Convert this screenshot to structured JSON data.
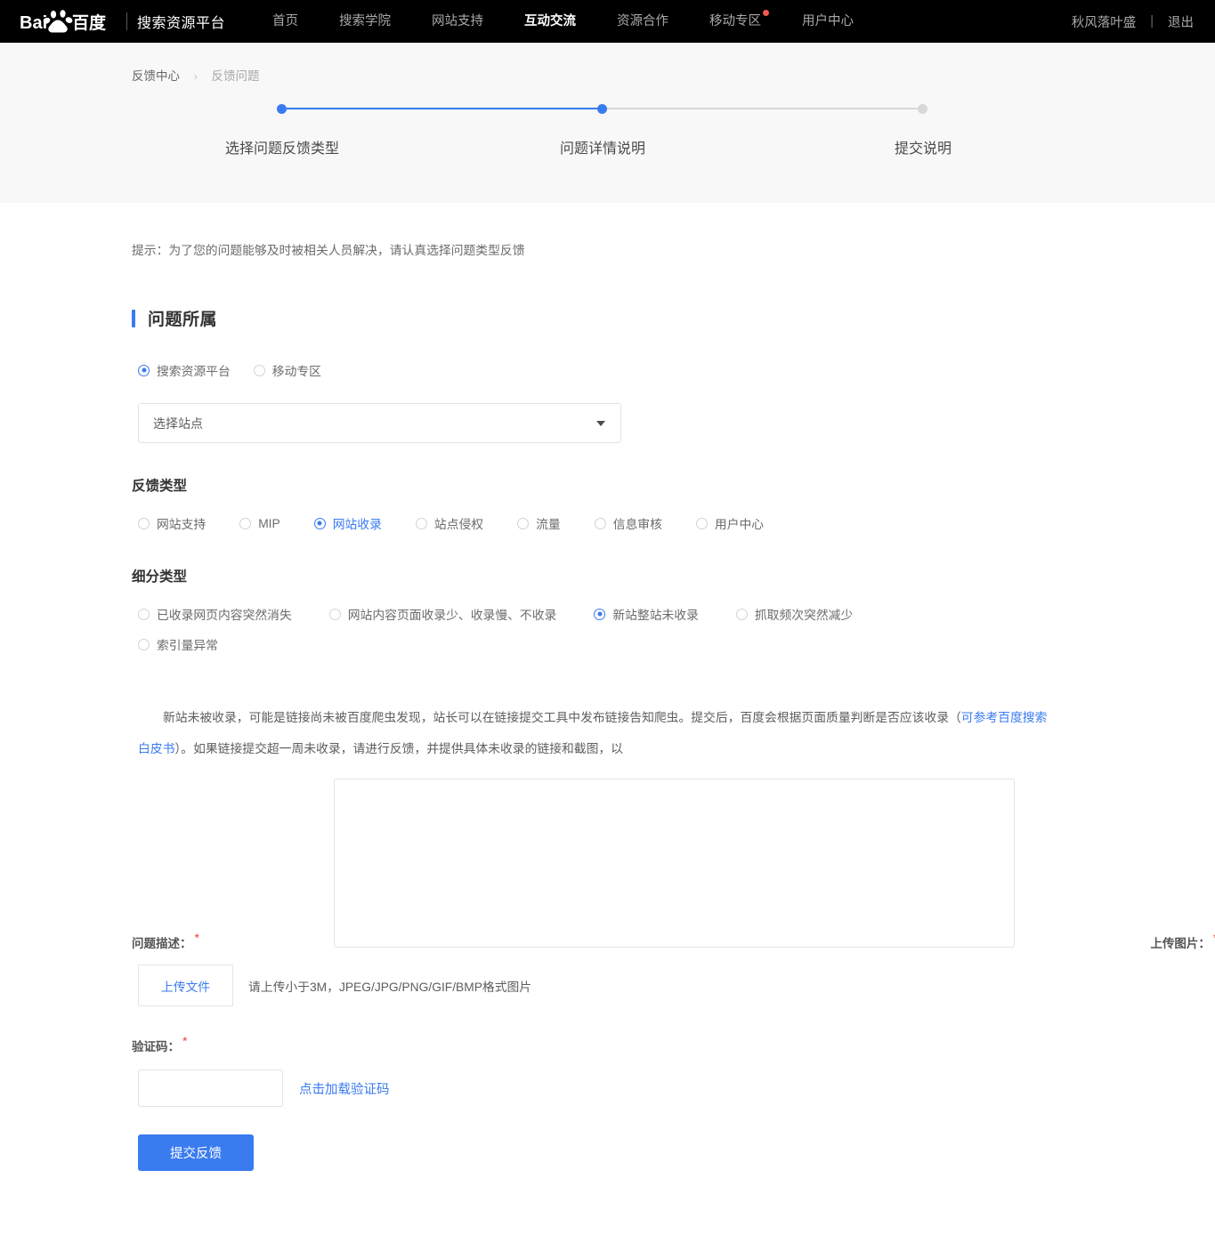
{
  "nav": {
    "brand": "搜索资源平台",
    "logo_text": "Bai百度",
    "items": [
      {
        "label": "首页",
        "active": false,
        "badge": false
      },
      {
        "label": "搜索学院",
        "active": false,
        "badge": false
      },
      {
        "label": "网站支持",
        "active": false,
        "badge": false
      },
      {
        "label": "互动交流",
        "active": true,
        "badge": false
      },
      {
        "label": "资源合作",
        "active": false,
        "badge": false
      },
      {
        "label": "移动专区",
        "active": false,
        "badge": true
      },
      {
        "label": "用户中心",
        "active": false,
        "badge": false
      }
    ],
    "user": "秋风落叶盛",
    "separator": "|",
    "logout": "退出"
  },
  "breadcrumb": {
    "root": "反馈中心",
    "separator": "›",
    "current": "反馈问题"
  },
  "stepper": {
    "steps": [
      {
        "label": "选择问题反馈类型",
        "active": true
      },
      {
        "label": "问题详情说明",
        "active": true
      },
      {
        "label": "提交说明",
        "active": false
      }
    ]
  },
  "tip": "提示：为了您的问题能够及时被相关人员解决，请认真选择问题类型反馈",
  "section": {
    "title": "问题所属"
  },
  "platform_radios": [
    {
      "label": "搜索资源平台",
      "checked": true
    },
    {
      "label": "移动专区",
      "checked": false
    }
  ],
  "site_select": {
    "placeholder": "选择站点",
    "caret": "chevron-down-icon"
  },
  "feedback_type": {
    "heading": "反馈类型",
    "options": [
      {
        "label": "网站支持",
        "checked": false
      },
      {
        "label": "MIP",
        "checked": false
      },
      {
        "label": "网站收录",
        "checked": true
      },
      {
        "label": "站点侵权",
        "checked": false
      },
      {
        "label": "流量",
        "checked": false
      },
      {
        "label": "信息审核",
        "checked": false
      },
      {
        "label": "用户中心",
        "checked": false
      }
    ]
  },
  "sub_type": {
    "heading": "细分类型",
    "options": [
      {
        "label": "已收录网页内容突然消失",
        "checked": false
      },
      {
        "label": "网站内容页面收录少、收录慢、不收录",
        "checked": false
      },
      {
        "label": "新站整站未收录",
        "checked": true
      },
      {
        "label": "抓取频次突然减少",
        "checked": false
      },
      {
        "label": "索引量异常",
        "checked": false
      }
    ]
  },
  "description_paragraph": {
    "part1": "新站未被收录，可能是链接尚未被百度爬虫发现，站长可以在链接提交工具中发布链接告知爬虫。提交后，百度会根据页面质量判断是否应该收录（",
    "link": "可参考百度搜索白皮书",
    "part2": "）。如果链接提交超一周未收录，请进行反馈，并提供具体未收录的链接和截图，以"
  },
  "problem_description": {
    "label": "问题描述：",
    "required_mark": "*",
    "value": "",
    "placeholder": ""
  },
  "upload": {
    "label": "上传图片：",
    "required_mark": "*",
    "button": "上传文件",
    "hint": "请上传小于3M，JPEG/JPG/PNG/GIF/BMP格式图片"
  },
  "captcha": {
    "label": "验证码：",
    "required_mark": "*",
    "value": "",
    "placeholder": "",
    "reload_link": "点击加载验证码"
  },
  "submit": {
    "label": "提交反馈"
  },
  "colors": {
    "accent_blue": "#3a7bf0",
    "nav_black": "#000000",
    "badge_red": "#f05a4f",
    "step_bg": "#f8f8f8",
    "muted_gray": "#d8d8d8"
  }
}
